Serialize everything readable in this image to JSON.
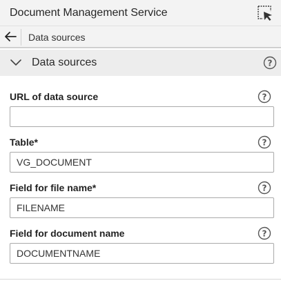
{
  "header": {
    "title": "Document Management Service",
    "pick_icon": "cursor-select-icon"
  },
  "breadcrumb": {
    "back_icon": "arrow-left-icon",
    "current": "Data sources"
  },
  "section": {
    "title": "Data sources",
    "expanded": true,
    "help_icon": "question-circle-icon"
  },
  "fields": [
    {
      "label": "URL of data source",
      "value": "",
      "placeholder": ""
    },
    {
      "label": "Table*",
      "value": "VG_DOCUMENT"
    },
    {
      "label": "Field for file name*",
      "value": "FILENAME"
    },
    {
      "label": "Field for document name",
      "value": "DOCUMENTNAME"
    }
  ]
}
